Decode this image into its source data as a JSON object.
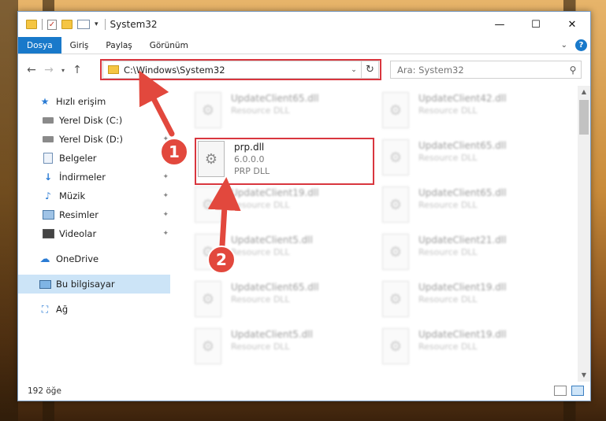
{
  "window": {
    "title": "System32",
    "minimize": "—",
    "maximize": "☐",
    "close": "✕"
  },
  "ribbon": {
    "tabs": [
      "Dosya",
      "Giriş",
      "Paylaş",
      "Görünüm"
    ],
    "collapse": "⌄",
    "help": "?"
  },
  "nav": {
    "back": "←",
    "forward": "→",
    "recent": "▾",
    "up": "↑",
    "address": "C:\\Windows\\System32",
    "address_drop": "⌄",
    "refresh": "↻",
    "search_placeholder": "Ara: System32",
    "search_icon": "⚲"
  },
  "sidebar": {
    "items": [
      {
        "label": "Hızlı erişim",
        "icon": "star-icon",
        "pinned": false
      },
      {
        "label": "Yerel Disk (C:)",
        "icon": "disk-icon",
        "pinned": true
      },
      {
        "label": "Yerel Disk (D:)",
        "icon": "disk-icon",
        "pinned": true
      },
      {
        "label": "Belgeler",
        "icon": "documents-icon",
        "pinned": true
      },
      {
        "label": "İndirmeler",
        "icon": "download-icon",
        "pinned": true
      },
      {
        "label": "Müzik",
        "icon": "music-icon",
        "pinned": true
      },
      {
        "label": "Resimler",
        "icon": "pictures-icon",
        "pinned": true
      },
      {
        "label": "Videolar",
        "icon": "video-icon",
        "pinned": true
      },
      {
        "label": "OneDrive",
        "icon": "cloud-icon",
        "pinned": false
      },
      {
        "label": "Bu bilgisayar",
        "icon": "computer-icon",
        "pinned": false
      },
      {
        "label": "Ağ",
        "icon": "network-icon",
        "pinned": false
      }
    ],
    "pin_glyph": "📌"
  },
  "files": [
    {
      "name": "UpdateClient65.dll",
      "sub1": "Resource DLL",
      "sub2": ""
    },
    {
      "name": "UpdateClient42.dll",
      "sub1": "Resource DLL",
      "sub2": ""
    },
    {
      "name": "prp.dll",
      "sub1": "6.0.0.0",
      "sub2": "PRP DLL"
    },
    {
      "name": "UpdateClient65.dll",
      "sub1": "Resource DLL",
      "sub2": ""
    },
    {
      "name": "UpdateClient19.dll",
      "sub1": "Resource DLL",
      "sub2": ""
    },
    {
      "name": "UpdateClient65.dll",
      "sub1": "Resource DLL",
      "sub2": ""
    },
    {
      "name": "UpdateClient5.dll",
      "sub1": "Resource DLL",
      "sub2": ""
    },
    {
      "name": "UpdateClient21.dll",
      "sub1": "Resource DLL",
      "sub2": ""
    },
    {
      "name": "UpdateClient65.dll",
      "sub1": "Resource DLL",
      "sub2": ""
    },
    {
      "name": "UpdateClient19.dll",
      "sub1": "Resource DLL",
      "sub2": ""
    },
    {
      "name": "UpdateClient5.dll",
      "sub1": "Resource DLL",
      "sub2": ""
    },
    {
      "name": "UpdateClient19.dll",
      "sub1": "Resource DLL",
      "sub2": ""
    }
  ],
  "status": {
    "count": "192 öğe"
  },
  "annotations": {
    "step1": "1",
    "step2": "2"
  },
  "colors": {
    "accent": "#1979ca",
    "highlight": "#d9363e",
    "selection": "#cce4f7"
  }
}
